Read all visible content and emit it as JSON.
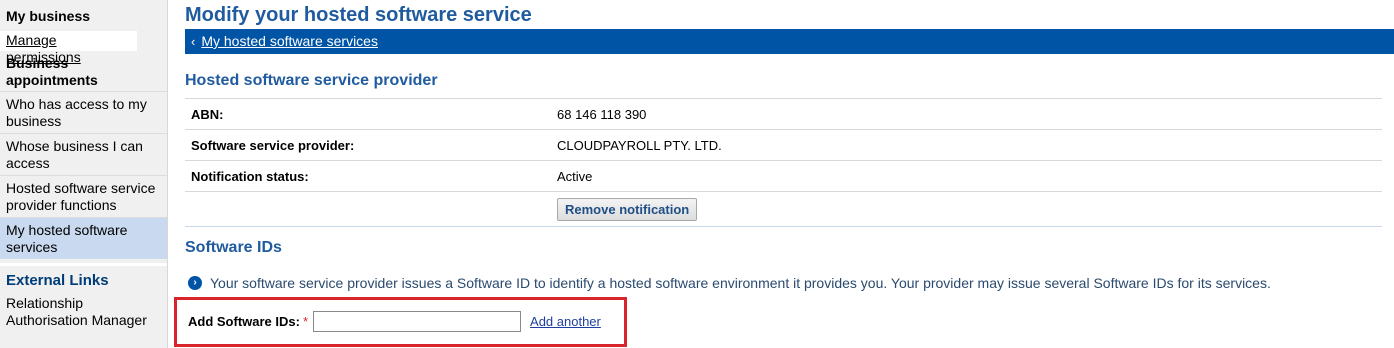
{
  "sidebar": {
    "my_business_head": "My business",
    "manage_permissions": "Manage permissions",
    "business_appointments_head": "Business appointments",
    "items": [
      {
        "label": "Who has access to my business"
      },
      {
        "label": "Whose business I can access"
      },
      {
        "label": "Hosted software service provider functions"
      },
      {
        "label": "My hosted software services"
      }
    ],
    "external_links_head": "External Links",
    "external_items": [
      {
        "label": "Relationship Authorisation Manager"
      }
    ]
  },
  "header": {
    "title": "Modify your hosted software service",
    "breadcrumb_link": "My hosted software services"
  },
  "provider_section": {
    "title": "Hosted software service provider",
    "rows": [
      {
        "label": "ABN:",
        "value": "68 146 118 390"
      },
      {
        "label": "Software service provider:",
        "value": "CLOUDPAYROLL PTY. LTD."
      },
      {
        "label": "Notification status:",
        "value": "Active"
      }
    ],
    "remove_button": "Remove notification"
  },
  "software_ids": {
    "title": "Software IDs",
    "info_text": "Your software service provider issues a Software ID to identify a hosted software environment it provides you. Your provider may issue several Software IDs for its services.",
    "add_label": "Add Software IDs:",
    "required_mark": "*",
    "input_value": "",
    "add_another": "Add another"
  },
  "colors": {
    "nav_bar": "#0054a6",
    "title": "#1f5b9e",
    "highlight": "#d8242c"
  }
}
